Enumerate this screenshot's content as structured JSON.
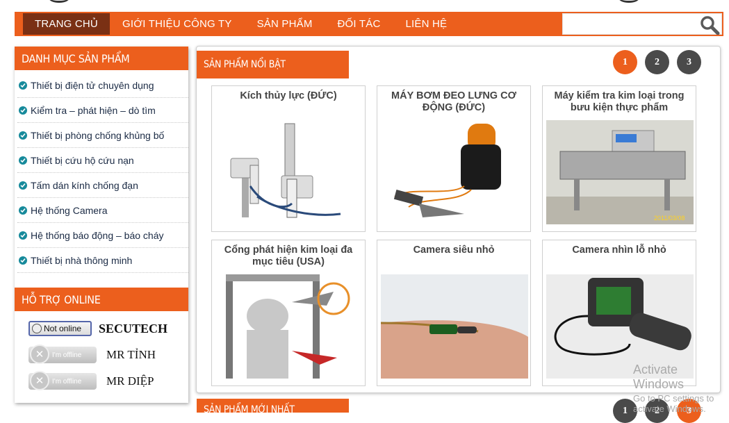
{
  "nav": {
    "items": [
      {
        "label": "TRANG CHỦ"
      },
      {
        "label": "GIỚI THIỆU CÔNG TY"
      },
      {
        "label": "SẢN PHẨM"
      },
      {
        "label": "ĐỐI TÁC"
      },
      {
        "label": "LIÊN HỆ"
      }
    ],
    "search_placeholder": ""
  },
  "sidebar": {
    "category_title": "DANH MỤC SẢN PHẨM",
    "categories": [
      "Thiết bị điện tử chuyên dụng",
      "Kiểm tra – phát hiện – dò tìm",
      "Thiết bị phòng chống khủng bố",
      "Thiết bị cứu hộ cứu nạn",
      "Tấm dán kính chống đạn",
      "Hệ thống Camera",
      "Hệ thống báo động – báo cháy",
      "Thiết bị nhà thông minh"
    ],
    "support_title": "HỖ TRỢ ONLINE",
    "support": [
      {
        "status": "Not online",
        "name": "SECUTECH"
      },
      {
        "status": "I'm offline",
        "name": "MR TỈNH"
      },
      {
        "status": "I'm offline",
        "name": "MR DIỆP"
      }
    ]
  },
  "featured": {
    "title": "SẢN PHẨM NỔI BẬT",
    "pages": [
      "1",
      "2",
      "3"
    ],
    "products": [
      {
        "title": "Kích thủy lực (ĐỨC)"
      },
      {
        "title": "MÁY BƠM ĐEO LƯNG CƠ ĐỘNG (ĐỨC)"
      },
      {
        "title": "Máy kiểm tra kim loại trong bưu kiện thực phẩm",
        "image_text": "2011/03/08"
      },
      {
        "title": "Cổng phát hiện kim loại đa mục tiêu (USA)"
      },
      {
        "title": "Camera siêu nhỏ"
      },
      {
        "title": "Camera nhìn lỗ nhỏ"
      }
    ]
  },
  "newest": {
    "title": "SẢN PHẨM MỚI NHẤT",
    "pages": [
      "1",
      "2",
      "3"
    ]
  },
  "watermark": {
    "line1": "Activate Windows",
    "line2": "Go to PC settings to activate Windows."
  },
  "colors": {
    "brand": "#ec5f1d",
    "nav_active": "#7a3014",
    "bullet": "#178a9b"
  }
}
